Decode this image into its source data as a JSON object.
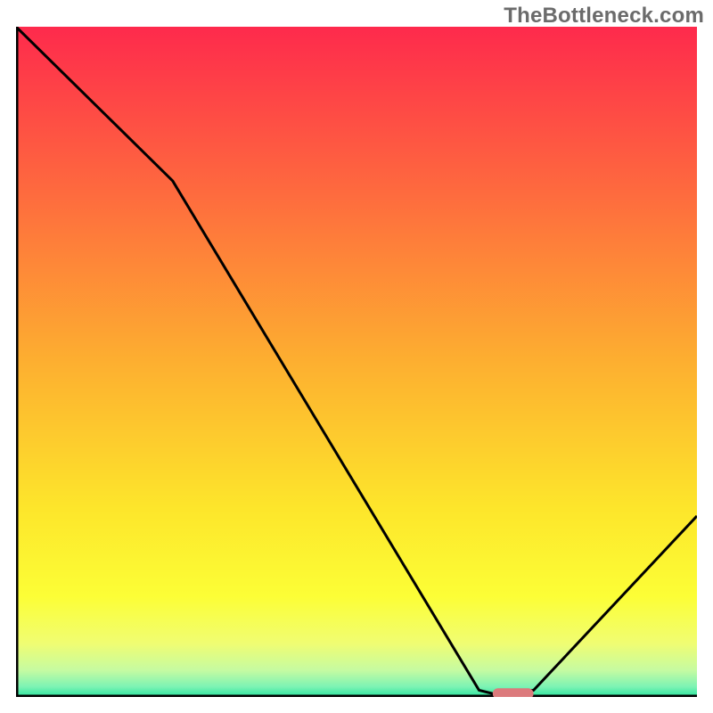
{
  "branding": {
    "watermark": "TheBottleneck.com"
  },
  "chart_data": {
    "type": "line",
    "title": "",
    "xlabel": "",
    "ylabel": "",
    "xlim": [
      0,
      100
    ],
    "ylim": [
      0,
      100
    ],
    "grid": false,
    "legend": null,
    "x": [
      0,
      23,
      68,
      70,
      76,
      100
    ],
    "values": [
      100,
      77,
      1,
      0.5,
      1,
      27
    ],
    "annotations": [
      {
        "text": "",
        "x": 73,
        "y": 0.5
      }
    ],
    "marker": {
      "x_start": 70,
      "x_end": 76,
      "y": 0.5,
      "color": "#dc7a7c"
    },
    "background_gradient": {
      "stops": [
        {
          "offset": 0.0,
          "color": "#fe2a4c"
        },
        {
          "offset": 0.25,
          "color": "#fe6b3e"
        },
        {
          "offset": 0.5,
          "color": "#fdaf30"
        },
        {
          "offset": 0.72,
          "color": "#fde62b"
        },
        {
          "offset": 0.85,
          "color": "#fcfe36"
        },
        {
          "offset": 0.92,
          "color": "#f0fd72"
        },
        {
          "offset": 0.96,
          "color": "#c6fba1"
        },
        {
          "offset": 0.985,
          "color": "#7bf3b4"
        },
        {
          "offset": 1.0,
          "color": "#2be49e"
        }
      ]
    },
    "stroke_color": "#000000",
    "axis_color": "#000000"
  }
}
